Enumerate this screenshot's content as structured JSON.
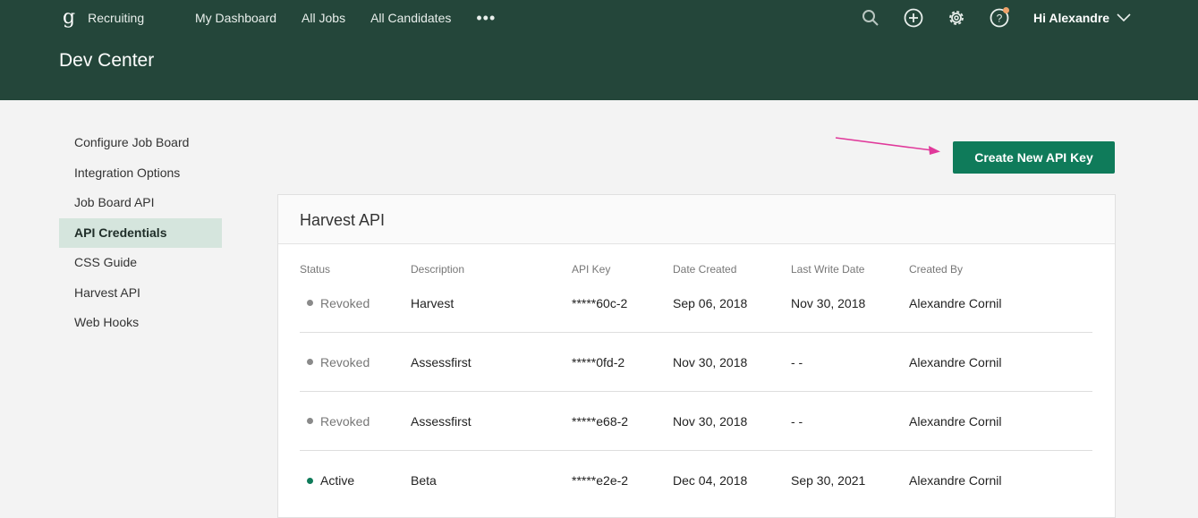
{
  "header": {
    "app_name": "Recruiting",
    "nav": [
      "My Dashboard",
      "All Jobs",
      "All Candidates"
    ],
    "more_label": "•••",
    "greeting": "Hi Alexandre",
    "page_title": "Dev Center",
    "icons": [
      "search-icon",
      "add-icon",
      "settings-gear-icon",
      "help-icon",
      "chevron-down-icon"
    ]
  },
  "sidebar": {
    "items": [
      {
        "label": "Configure Job Board"
      },
      {
        "label": "Integration Options"
      },
      {
        "label": "Job Board API"
      },
      {
        "label": "API Credentials",
        "active": true
      },
      {
        "label": "CSS Guide"
      },
      {
        "label": "Harvest API"
      },
      {
        "label": "Web Hooks"
      }
    ]
  },
  "actions": {
    "create_label": "Create New API Key"
  },
  "card": {
    "title": "Harvest API",
    "columns": [
      "Status",
      "Description",
      "API Key",
      "Date Created",
      "Last Write Date",
      "Created By"
    ],
    "rows": [
      {
        "status": "Revoked",
        "description": "Harvest",
        "api_key": "*****60c-2",
        "date_created": "Sep 06, 2018",
        "last_write": "Nov 30, 2018",
        "created_by": "Alexandre Cornil"
      },
      {
        "status": "Revoked",
        "description": "Assessfirst",
        "api_key": "*****0fd-2",
        "date_created": "Nov 30, 2018",
        "last_write": "- -",
        "created_by": "Alexandre Cornil"
      },
      {
        "status": "Revoked",
        "description": "Assessfirst",
        "api_key": "*****e68-2",
        "date_created": "Nov 30, 2018",
        "last_write": "- -",
        "created_by": "Alexandre Cornil"
      },
      {
        "status": "Active",
        "description": "Beta",
        "api_key": "*****e2e-2",
        "date_created": "Dec 04, 2018",
        "last_write": "Sep 30, 2021",
        "created_by": "Alexandre Cornil"
      }
    ]
  },
  "colors": {
    "header_bg": "#24463a",
    "accent": "#0f7b5a",
    "active_nav_bg": "#d5e5dd",
    "status_revoked": "#8a8a8a",
    "status_active": "#0f7b5a",
    "annotation_arrow": "#e0389a",
    "notification_dot": "#f0a36a"
  }
}
